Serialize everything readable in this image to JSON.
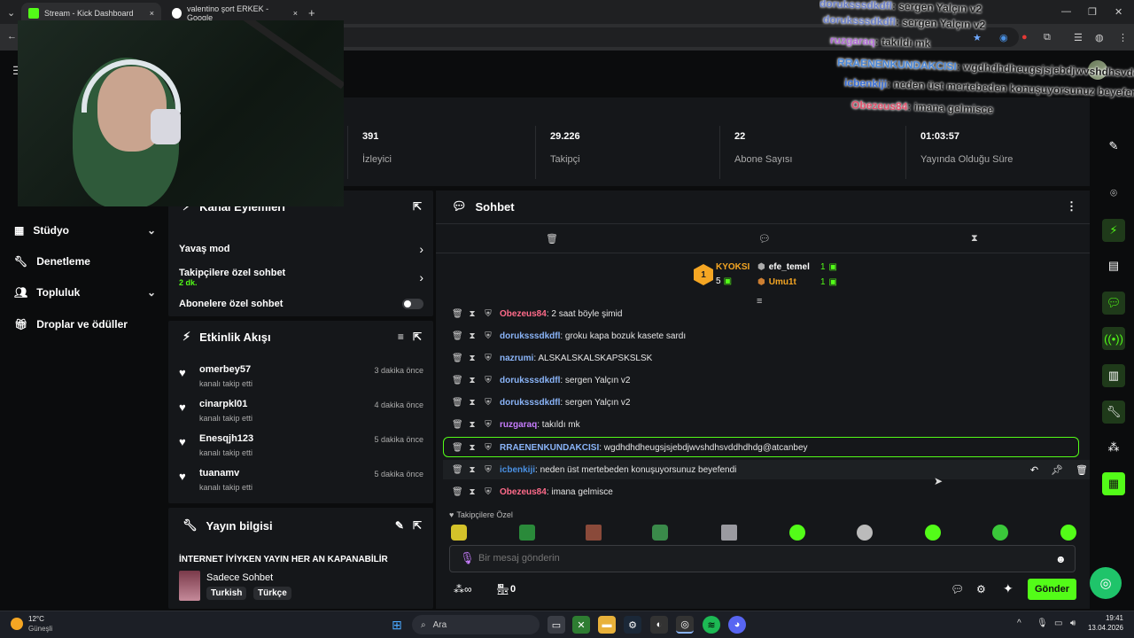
{
  "browser": {
    "tabs": [
      {
        "title": "Stream - Kick Dashboard",
        "close": "×"
      },
      {
        "title": "valentino şort ERKEK - Google ",
        "close": "×"
      }
    ],
    "new_tab": "+"
  },
  "nav": {
    "items": [
      {
        "label": "Stüdyo",
        "icon": "grid-icon",
        "has_chevron": true
      },
      {
        "label": "Denetleme",
        "icon": "wrench-icon",
        "has_chevron": false
      },
      {
        "label": "Topluluk",
        "icon": "people-icon",
        "has_chevron": true
      },
      {
        "label": "Droplar ve ödüller",
        "icon": "gift-icon",
        "has_chevron": false
      }
    ]
  },
  "stats": [
    {
      "value": "391",
      "label": "İzleyici"
    },
    {
      "value": "29.226",
      "label": "Takipçi"
    },
    {
      "value": "22",
      "label": "Abone Sayısı"
    },
    {
      "value": "01:03:57",
      "label": "Yayında Olduğu Süre"
    }
  ],
  "channel_actions": {
    "title": "Kanal Eylemleri",
    "items": [
      {
        "label": "Yavaş mod",
        "sub": ""
      },
      {
        "label": "Takipçilere özel sohbet",
        "sub": "2 dk."
      },
      {
        "label": "Abonelere özel sohbet",
        "sub": ""
      }
    ]
  },
  "activity": {
    "title": "Etkinlik Akışı",
    "items": [
      {
        "user": "omerbey57",
        "action": "kanalı takip etti",
        "time": "3 dakika önce"
      },
      {
        "user": "cinarpkl01",
        "action": "kanalı takip etti",
        "time": "4 dakika önce"
      },
      {
        "user": "Enesqjh123",
        "action": "kanalı takip etti",
        "time": "5 dakika önce"
      },
      {
        "user": "tuanamv",
        "action": "kanalı takip etti",
        "time": "5 dakika önce"
      }
    ]
  },
  "stream_info": {
    "title": "Yayın bilgisi",
    "stream_title": "İNTERNET İYİYKEN YAYIN HER AN KAPANABİLİR",
    "category": "Sadece Sohbet",
    "tags": [
      "Turkish",
      "Türkçe"
    ]
  },
  "chat": {
    "title": "Sohbet",
    "leaderboard": {
      "top_name": "KYOKSI",
      "top_rank": "1",
      "top_count": "5",
      "others": [
        {
          "name": "efe_temel",
          "count": "1"
        },
        {
          "name": "Umu1t",
          "count": "1"
        }
      ]
    },
    "messages": [
      {
        "user": "Obezeus84",
        "text": ": 2 saat böyle şimid",
        "color": "#ff6b8a"
      },
      {
        "user": "doruksssdkdfl",
        "text": ": groku kapa bozuk kasete sardı",
        "color": "#8ab4f8"
      },
      {
        "user": "nazrumi",
        "text": ": ALSKALSKALSKAPSKSLSK",
        "color": "#8ab4f8"
      },
      {
        "user": "doruksssdkdfl",
        "text": ": sergen Yalçın v2",
        "color": "#8ab4f8"
      },
      {
        "user": "doruksssdkdfl",
        "text": ": sergen Yalçın v2",
        "color": "#8ab4f8"
      },
      {
        "user": "ruzgaraq",
        "text": ": takıldı mk",
        "color": "#c77dff"
      },
      {
        "user": "RRAENENKUNDAKCISI",
        "text": ": wgdhdhdheugsjsjebdjwvshdhsvddhdhdg@atcanbey",
        "color": "#8ab4f8"
      },
      {
        "user": "icbenkiji",
        "text": ": neden üst mertebeden konuşuyorsunuz beyefendi",
        "color": "#4a90e2"
      },
      {
        "user": "Obezeus84",
        "text": ": imana gelmisce",
        "color": "#ff6b8a"
      }
    ],
    "followers_only_label": "Takipçilere Özel",
    "input_placeholder": "Bir mesaj gönderin",
    "footer_count": "0",
    "send_label": "Gönder"
  },
  "overlay": {
    "lines": [
      {
        "user": "doruksssdkdfl",
        "text": ": sergen Yalçın v2",
        "color": "#6b7fc8"
      },
      {
        "user": "doruksssdkdfl",
        "text": ": sergen Yalçın v2",
        "color": "#6b7fc8"
      },
      {
        "user": "ruzgaraq",
        "text": ": takıldı mk",
        "color": "#b06ad6"
      },
      {
        "user": "RRAENENKUNDAKCISI",
        "text": ": wgdhdhdheugsjsjebdjwvshdhsvddhdhdg",
        "color": "#4a86d6"
      },
      {
        "user": "icbenkiji",
        "text": ": neden üst mertebeden konuşuyorsunuz beyefendi",
        "color": "#3a6fd6"
      },
      {
        "user": "Obezeus84",
        "text": ": imana gelmisce",
        "color": "#e0506b"
      }
    ]
  },
  "taskbar": {
    "weather_temp": "12°C",
    "weather_desc": "Güneşli",
    "search_label": "Ara",
    "time": "19:41",
    "date": "13.04.2026"
  },
  "colors": {
    "accent": "#53fc18",
    "panel": "#15171a",
    "background": "#0b0c0d"
  }
}
